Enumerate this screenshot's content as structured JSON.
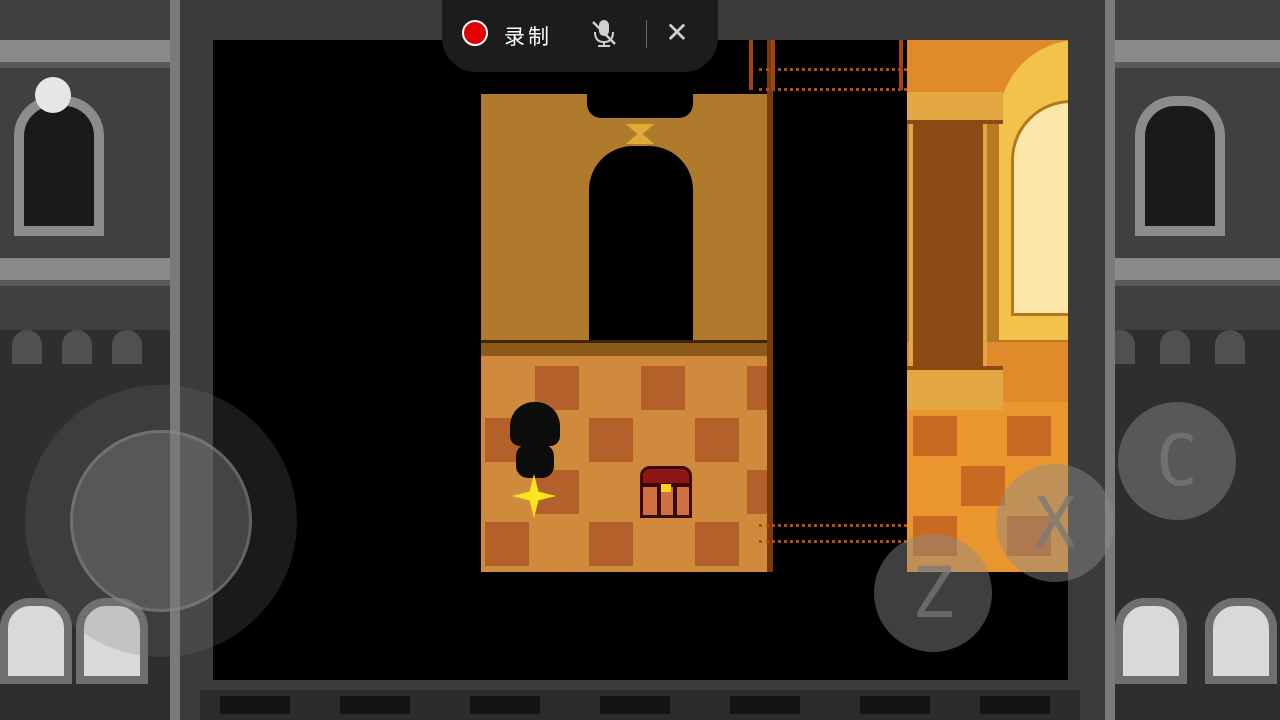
{
  "recording_bar": {
    "label": "录制",
    "record_indicator_color": "#e40000",
    "mic_icon": "mic-muted-icon",
    "close_glyph": "✕"
  },
  "controls": {
    "button_c": "C",
    "button_x": "X",
    "button_z": "Z"
  },
  "colors": {
    "wall": "#b07a2c",
    "floor": "#d08a3c",
    "floor_tile": "#b4602a",
    "save_point": "#ffe81a",
    "chest_lid": "#8e1616"
  }
}
